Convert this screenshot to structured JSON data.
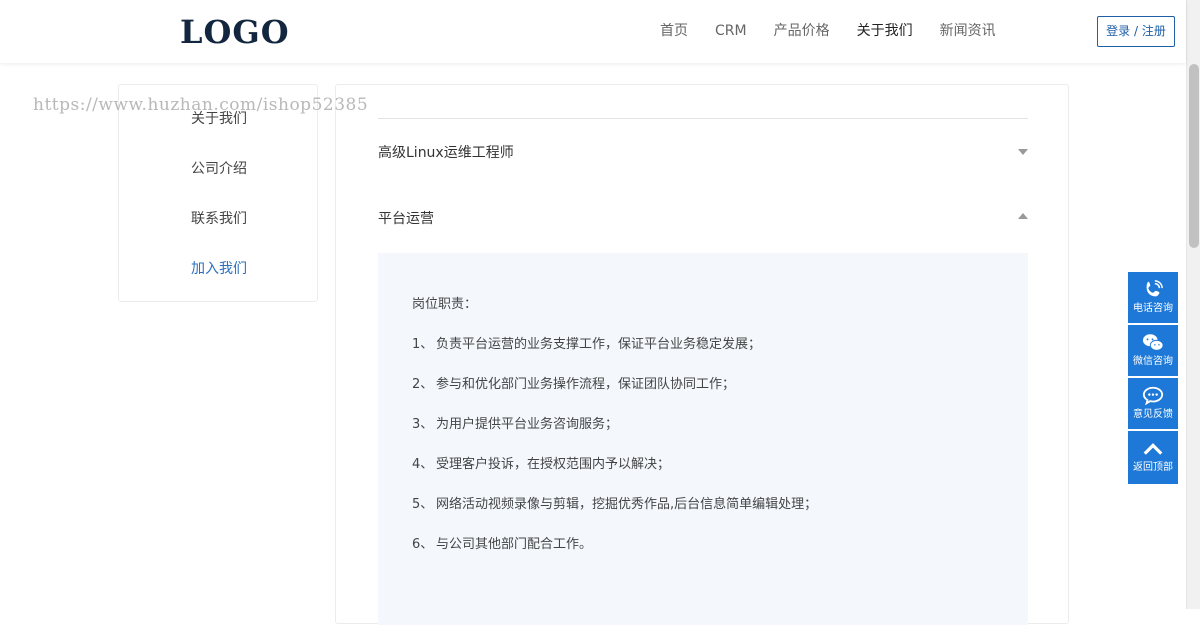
{
  "header": {
    "logo": "LOGO",
    "nav": [
      {
        "label": "首页",
        "active": false
      },
      {
        "label": "CRM",
        "active": false
      },
      {
        "label": "产品价格",
        "active": false
      },
      {
        "label": "关于我们",
        "active": true
      },
      {
        "label": "新闻资讯",
        "active": false
      }
    ],
    "login_label": "登录 / 注册"
  },
  "watermark": "https://www.huzhan.com/ishop52385",
  "sidebar": {
    "items": [
      {
        "label": "关于我们"
      },
      {
        "label": "公司介绍"
      },
      {
        "label": "联系我们"
      },
      {
        "label": "加入我们",
        "active": true
      }
    ]
  },
  "jobs": [
    {
      "title": "高级Linux运维工程师",
      "expanded": false
    },
    {
      "title": "平台运营",
      "expanded": true
    }
  ],
  "detail": {
    "heading": "岗位职责：",
    "duties": [
      {
        "num": "1、",
        "text": "负责平台运营的业务支撑工作，保证平台业务稳定发展；"
      },
      {
        "num": "2、",
        "text": "参与和优化部门业务操作流程，保证团队协同工作；"
      },
      {
        "num": "3、",
        "text": "为用户提供平台业务咨询服务；"
      },
      {
        "num": "4、",
        "text": "受理客户投诉，在授权范围内予以解决；"
      },
      {
        "num": "5、",
        "text": "网络活动视频录像与剪辑，挖掘优秀作品,后台信息简单编辑处理；"
      },
      {
        "num": "6、",
        "text": "与公司其他部门配合工作。"
      }
    ]
  },
  "float_buttons": [
    {
      "label": "电话咨询",
      "icon": "phone-icon"
    },
    {
      "label": "微信咨询",
      "icon": "wechat-icon"
    },
    {
      "label": "意见反馈",
      "icon": "chat-bubble-icon"
    },
    {
      "label": "返回顶部",
      "icon": "chevron-up-icon"
    }
  ],
  "colors": {
    "accent": "#1e78d7",
    "logo": "#12263f",
    "active_link": "#2d6fc0",
    "detail_bg": "#f4f8fd"
  }
}
